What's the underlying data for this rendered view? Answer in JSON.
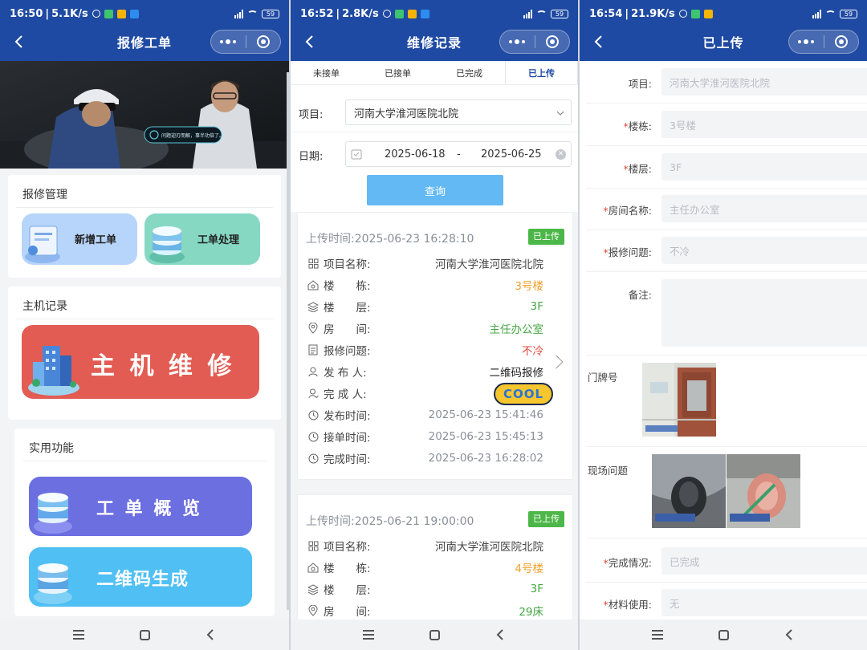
{
  "screens": [
    {
      "status": {
        "time": "16:50",
        "speed": "5.1K/s",
        "battery": "59"
      },
      "nav": {
        "title": "报修工单"
      },
      "sections": [
        {
          "title": "报修管理",
          "tiles": [
            {
              "label": "新增工单"
            },
            {
              "label": "工单处理"
            }
          ]
        },
        {
          "title": "主机记录",
          "big_tile": {
            "label": "主 机 维 修"
          }
        },
        {
          "title": "实用功能",
          "tiles": [
            {
              "label": "工 单 概 览"
            },
            {
              "label": "二维码生成"
            }
          ]
        }
      ],
      "hero": {
        "bubble_text": "问题迎刃而解，事半功倍了。"
      }
    },
    {
      "status": {
        "time": "16:52",
        "speed": "2.8K/s",
        "battery": "59"
      },
      "nav": {
        "title": "维修记录"
      },
      "tabs": [
        {
          "label": "未接单"
        },
        {
          "label": "已接单"
        },
        {
          "label": "已完成"
        },
        {
          "label": "已上传"
        }
      ],
      "filter": {
        "project_label": "项目:",
        "project_value": "河南大学淮河医院北院",
        "date_label": "日期:",
        "date_start": "2025-06-18",
        "date_sep": "-",
        "date_end": "2025-06-25",
        "query_label": "查询"
      },
      "records": [
        {
          "upload_time": "上传时间:2025-06-23 16:28:10",
          "badge": "已上传",
          "rows": [
            {
              "label": "项目名称:",
              "value": "河南大学淮河医院北院"
            },
            {
              "label": "楼　　栋:",
              "value": "3号楼"
            },
            {
              "label": "楼　　层:",
              "value": "3F"
            },
            {
              "label": "房　　间:",
              "value": "主任办公室"
            },
            {
              "label": "报修问题:",
              "value": "不冷"
            },
            {
              "label": "发 布 人:",
              "value": "二维码报修"
            },
            {
              "label": "完 成 人:",
              "value": ""
            },
            {
              "label": "发布时间:",
              "value": "2025-06-23 15:41:46"
            },
            {
              "label": "接单时间:",
              "value": "2025-06-23 15:45:13"
            },
            {
              "label": "完成时间:",
              "value": "2025-06-23 16:28:02"
            }
          ],
          "sticker": "COOL"
        },
        {
          "upload_time": "上传时间:2025-06-21 19:00:00",
          "badge": "已上传",
          "rows": [
            {
              "label": "项目名称:",
              "value": "河南大学淮河医院北院"
            },
            {
              "label": "楼　　栋:",
              "value": "4号楼"
            },
            {
              "label": "楼　　层:",
              "value": "3F"
            },
            {
              "label": "房　　间:",
              "value": "29床"
            }
          ]
        }
      ]
    },
    {
      "status": {
        "time": "16:54",
        "speed": "21.9K/s",
        "battery": "59"
      },
      "nav": {
        "title": "已上传"
      },
      "fields": [
        {
          "label": "项目:",
          "value": "河南大学淮河医院北院"
        },
        {
          "label": "楼栋:",
          "value": "3号楼"
        },
        {
          "label": "楼层:",
          "value": "3F"
        },
        {
          "label": "房间名称:",
          "value": "主任办公室"
        },
        {
          "label": "报修问题:",
          "value": "不冷"
        },
        {
          "label": "备注:",
          "value": ""
        },
        {
          "label": "门牌号",
          "value": ""
        },
        {
          "label": "现场问题",
          "value": ""
        },
        {
          "label": "完成情况:",
          "value": "已完成"
        },
        {
          "label": "材料使用:",
          "value": "无"
        }
      ]
    }
  ],
  "colors": {
    "header": "#1f4aa3",
    "query_button": "#63b9f4",
    "badge": "#4cb748",
    "orange": "#f0a12d",
    "green": "#46a743",
    "red": "#e0493c"
  }
}
